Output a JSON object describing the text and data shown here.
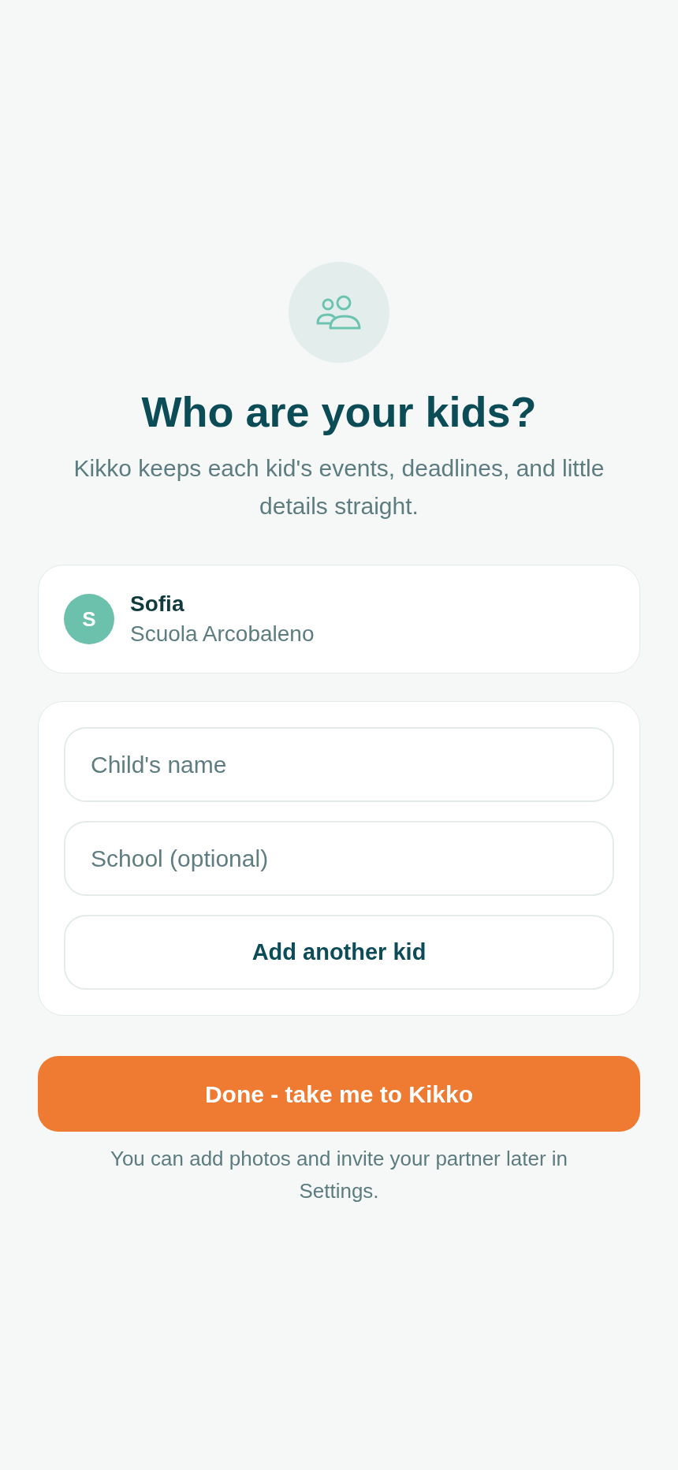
{
  "header": {
    "title": "Who are your kids?",
    "subtitle": "Kikko keeps each kid's events, deadlines, and little details straight."
  },
  "kids": [
    {
      "initial": "S",
      "name": "Sofia",
      "school": "Scuola Arcobaleno"
    }
  ],
  "form": {
    "fields": [
      {
        "placeholder": "Child's name"
      },
      {
        "placeholder": "School (optional)"
      }
    ],
    "add_button": "Add another kid"
  },
  "done_button": "Done - take me to Kikko",
  "footnote": "You can add photos and invite your partner later in Settings."
}
